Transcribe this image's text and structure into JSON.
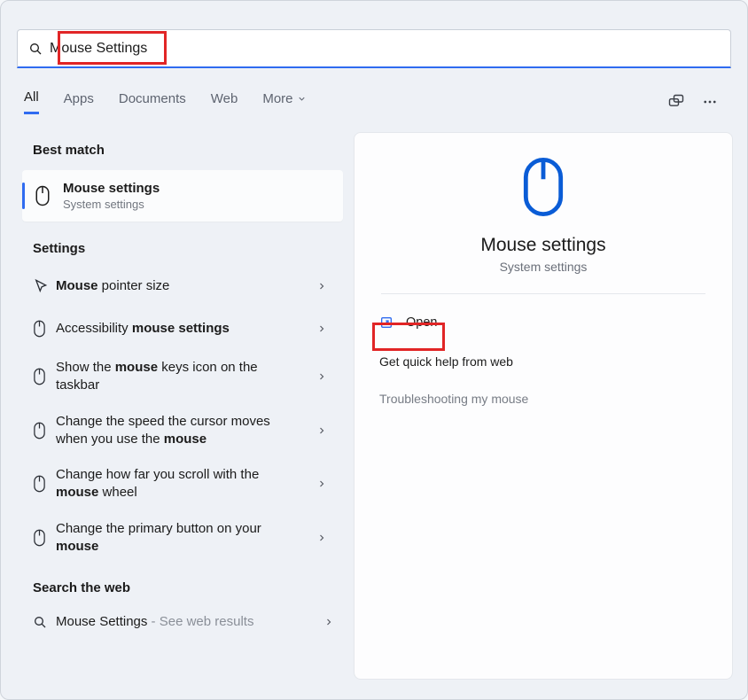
{
  "search": {
    "value": "Mouse Settings"
  },
  "tabs": {
    "all": "All",
    "apps": "Apps",
    "documents": "Documents",
    "web": "Web",
    "more": "More"
  },
  "left": {
    "best_match_heading": "Best match",
    "best_match": {
      "title": "Mouse settings",
      "subtitle": "System settings"
    },
    "settings_heading": "Settings",
    "items": [
      {
        "pre": "",
        "bold": "Mouse",
        "post": " pointer size"
      },
      {
        "pre": "Accessibility ",
        "bold": "mouse settings",
        "post": ""
      },
      {
        "pre": "Show the ",
        "bold": "mouse",
        "post": " keys icon on the taskbar"
      },
      {
        "pre": "Change the speed the cursor moves when you use the ",
        "bold": "mouse",
        "post": ""
      },
      {
        "pre": "Change how far you scroll with the ",
        "bold": "mouse",
        "post": " wheel"
      },
      {
        "pre": "Change the primary button on your ",
        "bold": "mouse",
        "post": ""
      }
    ],
    "search_web_heading": "Search the web",
    "web_item": {
      "label": "Mouse Settings",
      "suffix": " - See web results"
    }
  },
  "right": {
    "title": "Mouse settings",
    "subtitle": "System settings",
    "open_label": "Open",
    "quick_help": "Get quick help from web",
    "troubleshoot": "Troubleshooting my mouse"
  },
  "colors": {
    "accent": "#2f6bf0",
    "highlight": "#e12526"
  }
}
